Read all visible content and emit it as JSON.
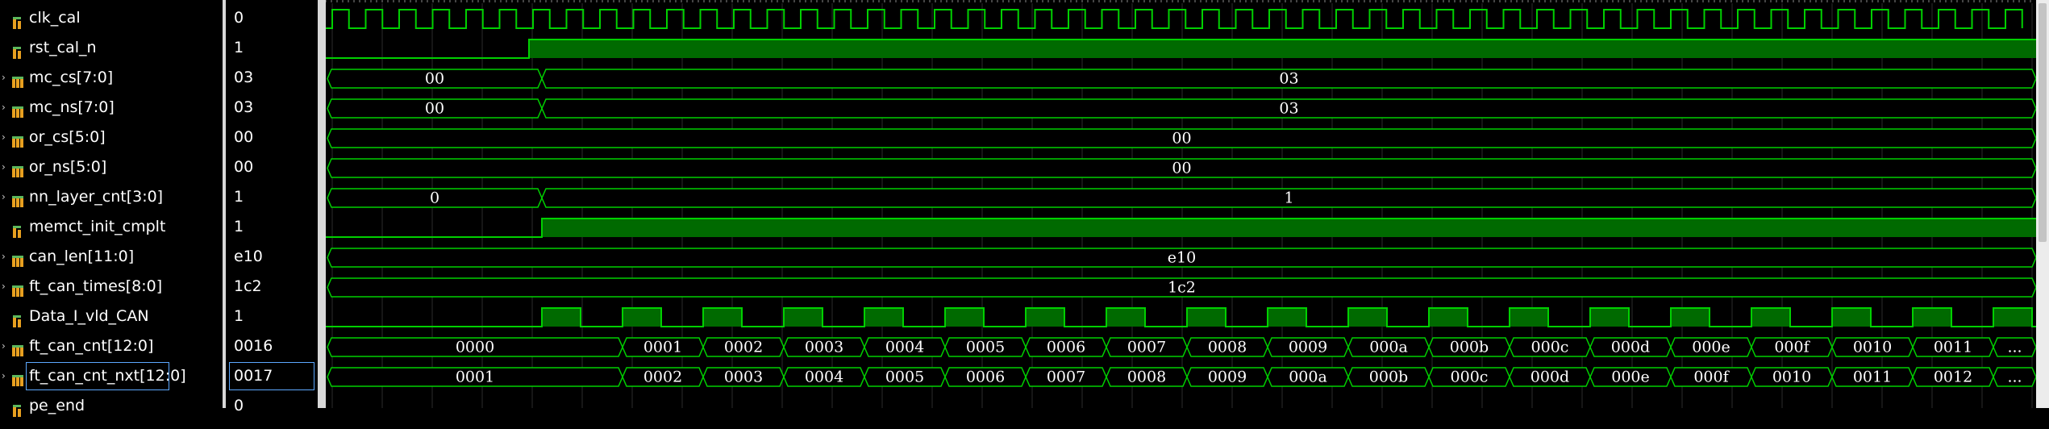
{
  "signals": [
    {
      "name": "clk_cal",
      "value": "0",
      "icon": "logic-signal-icon",
      "bus": false
    },
    {
      "name": "rst_cal_n",
      "value": "1",
      "icon": "logic-signal-icon",
      "bus": false
    },
    {
      "name": "mc_cs[7:0]",
      "value": "03",
      "icon": "bus-signal-icon",
      "bus": true
    },
    {
      "name": "mc_ns[7:0]",
      "value": "03",
      "icon": "bus-signal-icon",
      "bus": true
    },
    {
      "name": "or_cs[5:0]",
      "value": "00",
      "icon": "bus-signal-icon",
      "bus": true
    },
    {
      "name": "or_ns[5:0]",
      "value": "00",
      "icon": "bus-signal-icon",
      "bus": true
    },
    {
      "name": "nn_layer_cnt[3:0]",
      "value": "1",
      "icon": "bus-signal-icon",
      "bus": true
    },
    {
      "name": "memct_init_cmplt",
      "value": "1",
      "icon": "logic-signal-icon",
      "bus": false
    },
    {
      "name": "can_len[11:0]",
      "value": "e10",
      "icon": "bus-signal-icon",
      "bus": true
    },
    {
      "name": "ft_can_times[8:0]",
      "value": "1c2",
      "icon": "bus-signal-icon",
      "bus": true
    },
    {
      "name": "Data_I_vld_CAN",
      "value": "1",
      "icon": "logic-signal-icon",
      "bus": false
    },
    {
      "name": "ft_can_cnt[12:0]",
      "value": "0016",
      "icon": "bus-signal-icon",
      "bus": true
    },
    {
      "name": "ft_can_cnt_nxt[12:0]",
      "value": "0017",
      "icon": "bus-signal-icon",
      "bus": true,
      "selected": true
    },
    {
      "name": "pe_end",
      "value": "0",
      "icon": "logic-signal-icon",
      "bus": false
    }
  ],
  "waves": {
    "mc_cs": [
      "00",
      "03"
    ],
    "mc_ns": [
      "00",
      "03"
    ],
    "or_cs": [
      "00"
    ],
    "or_ns": [
      "00"
    ],
    "nn_layer_cnt": [
      "0",
      "1"
    ],
    "can_len": [
      "e10"
    ],
    "ft_can_times": [
      "1c2"
    ],
    "ft_can_cnt": [
      "0000",
      "0001",
      "0002",
      "0003",
      "0004",
      "0005",
      "0006",
      "0007",
      "0008",
      "0009",
      "000a",
      "000b",
      "000c",
      "000d",
      "000e",
      "000f",
      "0010",
      "0011",
      "..."
    ],
    "ft_can_cnt_nxt": [
      "0001",
      "0002",
      "0003",
      "0004",
      "0005",
      "0006",
      "0007",
      "0008",
      "0009",
      "000a",
      "000b",
      "000c",
      "000d",
      "000e",
      "000f",
      "0010",
      "0011",
      "0012",
      "..."
    ]
  },
  "colors": {
    "wave": "#00d000",
    "wave_fill": "#006a00",
    "grid": "#2c2c2c",
    "background": "#000000",
    "selection": "#5da8ff"
  }
}
